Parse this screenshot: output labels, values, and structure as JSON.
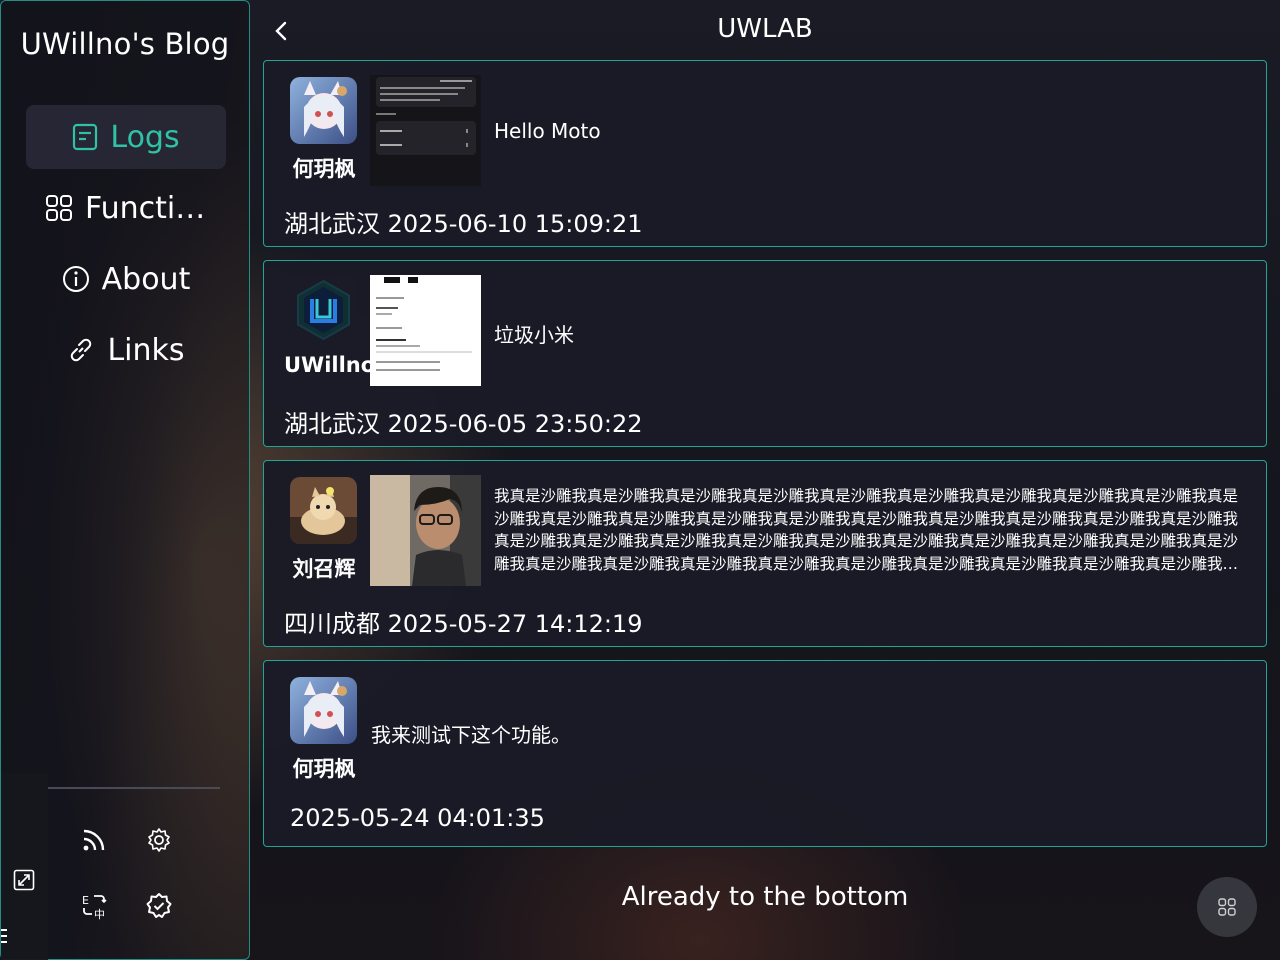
{
  "sidebar": {
    "title": "UWillno's Blog",
    "items": [
      {
        "label": "Logs",
        "icon": "document-icon",
        "active": true
      },
      {
        "label": "Functions",
        "icon": "grid-icon",
        "active": false
      },
      {
        "label": "About",
        "icon": "info-icon",
        "active": false
      },
      {
        "label": "Links",
        "icon": "link-icon",
        "active": false
      }
    ],
    "tools": [
      "rss-icon",
      "gear-icon",
      "translate-icon",
      "settings-badge-icon"
    ]
  },
  "header": {
    "title": "UWLAB",
    "back_icon": "chevron-left-icon"
  },
  "posts": [
    {
      "author": "何玥枫",
      "text": "Hello Moto",
      "location": "湖北武汉",
      "time": "2025-06-10 15:09:21",
      "has_image": true
    },
    {
      "author": "UWillno",
      "text": "垃圾小米",
      "location": "湖北武汉",
      "time": "2025-06-05 23:50:22",
      "has_image": true
    },
    {
      "author": "刘召辉",
      "text": "我真是沙雕我真是沙雕我真是沙雕我真是沙雕我真是沙雕我真是沙雕我真是沙雕我真是沙雕我真是沙雕我真是沙雕我真是沙雕我真是沙雕我真是沙雕我真是沙雕我真是沙雕我真是沙雕我真是沙雕我真是沙雕我真是沙雕我真是沙雕我真是沙雕我真是沙雕我真是沙雕我真是沙雕我真是沙雕我真是沙雕我真是沙雕我真是沙雕我真是沙雕我真是沙雕我真是沙雕我真是沙雕我真是沙雕我真是沙雕我真是沙雕我真是沙雕我真是沙雕我真是沙雕我真是沙雕我真是沙雕我真是沙雕我真是沙雕我真是...",
      "location": "四川成都",
      "time": "2025-05-27 14:12:19",
      "has_image": true
    },
    {
      "author": "何玥枫",
      "text": "我来测试下这个功能。",
      "location": "",
      "time": "2025-05-24 04:01:35",
      "has_image": false
    }
  ],
  "footer": {
    "bottom_note": "Already to the bottom",
    "fab_icon": "grid-icon"
  },
  "colors": {
    "accent": "#2fc3a5",
    "border": "#1fa593",
    "card_bg": "#1a1b26"
  }
}
